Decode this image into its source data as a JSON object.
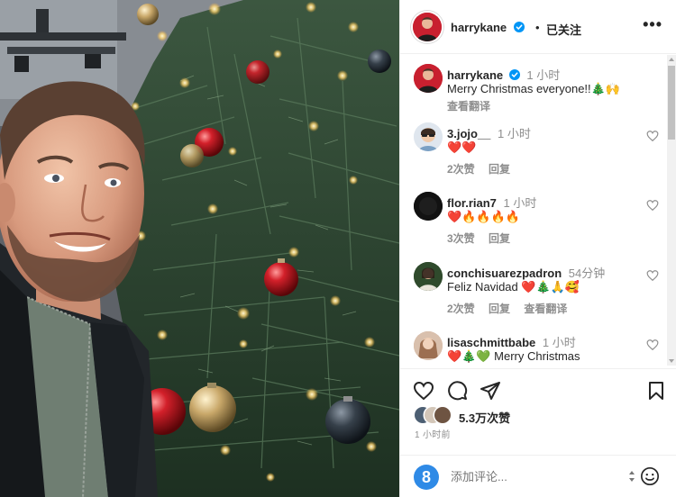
{
  "post": {
    "author": "harrykane",
    "follow_status": "已关注",
    "header_dot": "•",
    "more_label": "•••",
    "caption": {
      "username": "harrykane",
      "time": "1 小时",
      "text": "Merry Christmas everyone!!🎄🙌",
      "translate": "查看翻译"
    }
  },
  "comments": [
    {
      "username": "3.jojo__",
      "time": "1 小时",
      "text": "❤️❤️",
      "likes": "2次赞",
      "reply": "回复",
      "translate": ""
    },
    {
      "username": "flor.rian7",
      "time": "1 小时",
      "text": "❤️🔥🔥🔥🔥",
      "likes": "3次赞",
      "reply": "回复",
      "translate": ""
    },
    {
      "username": "conchisuarezpadron",
      "time": "54分钟",
      "text": "Feliz Navidad ❤️🎄🙏🥰",
      "likes": "2次赞",
      "reply": "回复",
      "translate": "查看翻译"
    },
    {
      "username": "lisaschmittbabe",
      "time": "1 小时",
      "text": "❤️🎄💚 Merry Christmas",
      "likes": "",
      "reply": "",
      "translate": ""
    }
  ],
  "actions": {
    "like_icon": "heart-icon",
    "comment_icon": "comment-icon",
    "share_icon": "send-icon",
    "save_icon": "bookmark-icon",
    "like_count": "5.3万次赞",
    "post_time": "1 小时前"
  },
  "add_comment": {
    "placeholder": "添加评论...",
    "badge": "8"
  },
  "colors": {
    "verified": "#0095f6",
    "heart_red": "#e0245e",
    "muted": "#8e8e8e",
    "border": "#efefef"
  }
}
